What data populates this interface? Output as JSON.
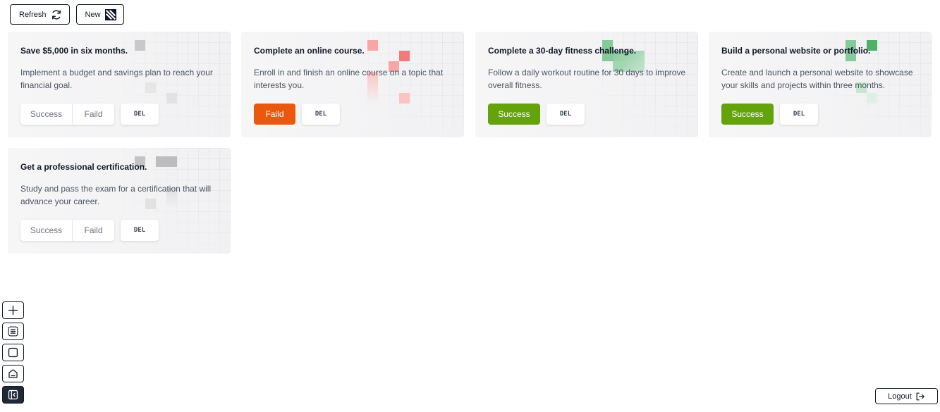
{
  "toolbar": {
    "refresh_label": "Refresh",
    "refresh_icon": "refresh-icon",
    "new_label": "New",
    "new_icon": "brand-logo-icon"
  },
  "status_labels": {
    "success": "Success",
    "faild": "Faild",
    "del": "DEL"
  },
  "colors": {
    "success": "#65a30d",
    "faild": "#ea580c",
    "pending_accent": "#9ca3af",
    "faild_accent": "#f87171",
    "success_accent": "#22a34a"
  },
  "goals": [
    {
      "title": "Save $5,000 in six months.",
      "description": "Implement a budget and savings plan to reach your financial goal.",
      "status": "pending"
    },
    {
      "title": "Complete an online course.",
      "description": "Enroll in and finish an online course on a topic that interests you.",
      "status": "faild"
    },
    {
      "title": "Complete a 30-day fitness challenge.",
      "description": "Follow a daily workout routine for 30 days to improve overall fitness.",
      "status": "success"
    },
    {
      "title": "Build a personal website or portfolio.",
      "description": "Create and launch a personal website to showcase your skills and projects within three months.",
      "status": "success"
    },
    {
      "title": "Get a professional certification.",
      "description": "Study and pass the exam for a certification that will advance your career.",
      "status": "pending"
    }
  ],
  "dock": {
    "items": [
      {
        "icon": "plus-icon"
      },
      {
        "icon": "list-icon"
      },
      {
        "icon": "square-icon"
      },
      {
        "icon": "home-icon"
      },
      {
        "icon": "sidebar-collapse-icon",
        "active": true
      }
    ]
  },
  "logout": {
    "label": "Logout",
    "icon": "logout-icon"
  }
}
